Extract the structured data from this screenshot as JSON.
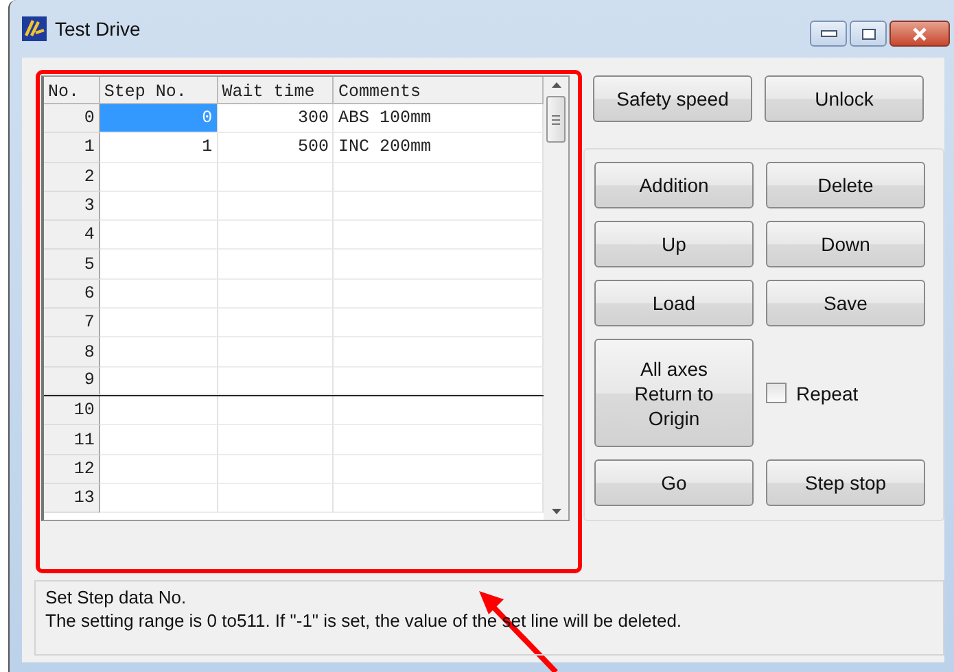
{
  "window": {
    "title": "Test Drive"
  },
  "table": {
    "columns": [
      "No.",
      "Step No.",
      "Wait time",
      "Comments"
    ],
    "rows": [
      {
        "no": "0",
        "step_no": "0",
        "wait_time": "300",
        "comments": "ABS 100mm",
        "selected": true
      },
      {
        "no": "1",
        "step_no": "1",
        "wait_time": "500",
        "comments": "INC 200mm",
        "selected": false
      },
      {
        "no": "2",
        "selected": false
      },
      {
        "no": "3",
        "selected": false
      },
      {
        "no": "4",
        "selected": false
      },
      {
        "no": "5",
        "selected": false
      },
      {
        "no": "6",
        "selected": false
      },
      {
        "no": "7",
        "selected": false
      },
      {
        "no": "8",
        "selected": false
      },
      {
        "no": "9",
        "selected": false
      },
      {
        "no": "10",
        "selected": false
      },
      {
        "no": "11",
        "selected": false
      },
      {
        "no": "12",
        "selected": false
      },
      {
        "no": "13",
        "selected": false
      }
    ]
  },
  "top_buttons": [
    "Safety speed",
    "Unlock"
  ],
  "group_buttons": [
    "Addition",
    "Delete",
    "Up",
    "Down",
    "Load",
    "Save"
  ],
  "origin_button": "All axes\nReturn to\nOrigin",
  "repeat": {
    "label": "Repeat",
    "checked": false
  },
  "bottom_buttons": [
    "Go",
    "Step stop"
  ],
  "help": {
    "lines": [
      "Set Step data No.",
      "The setting range is 0 to511.  If \"-1\" is set, the value of the set line will be deleted."
    ]
  },
  "annotations": {
    "highlight_box": true,
    "arrow": true
  }
}
